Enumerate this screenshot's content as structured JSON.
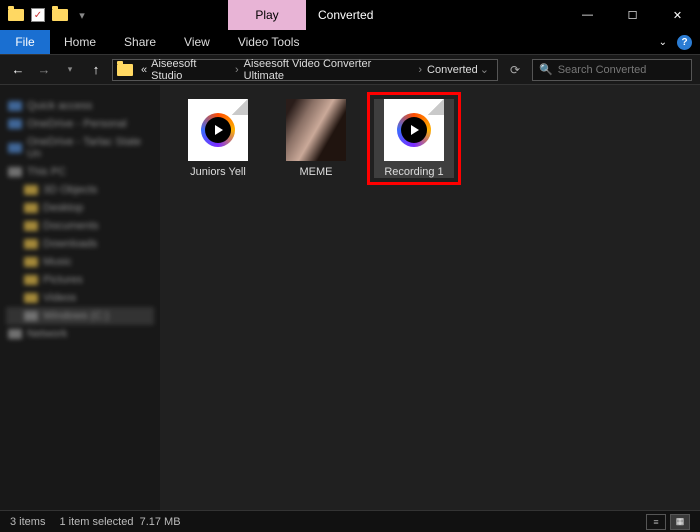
{
  "titlebar": {
    "contextual_tab": "Play",
    "window_title": "Converted",
    "minimize": "—",
    "maximize": "☐",
    "close": "✕"
  },
  "ribbon": {
    "file": "File",
    "tabs": [
      "Home",
      "Share",
      "View",
      "Video Tools"
    ]
  },
  "address": {
    "prefix": "«",
    "crumbs": [
      "Aiseesoft Studio",
      "Aiseesoft Video Converter Ultimate",
      "Converted"
    ],
    "search_placeholder": "Search Converted"
  },
  "sidebar": {
    "items": [
      {
        "label": "Quick access",
        "icon": "blue",
        "indent": false
      },
      {
        "label": "OneDrive - Personal",
        "icon": "blue",
        "indent": false
      },
      {
        "label": "OneDrive - Tarlac State Un",
        "icon": "blue",
        "indent": false
      },
      {
        "label": "This PC",
        "icon": "grey",
        "indent": false
      },
      {
        "label": "3D Objects",
        "icon": "default",
        "indent": true
      },
      {
        "label": "Desktop",
        "icon": "default",
        "indent": true
      },
      {
        "label": "Documents",
        "icon": "default",
        "indent": true
      },
      {
        "label": "Downloads",
        "icon": "default",
        "indent": true
      },
      {
        "label": "Music",
        "icon": "default",
        "indent": true
      },
      {
        "label": "Pictures",
        "icon": "default",
        "indent": true
      },
      {
        "label": "Videos",
        "icon": "default",
        "indent": true
      },
      {
        "label": "Windows (C:)",
        "icon": "grey",
        "indent": true,
        "sel": true
      },
      {
        "label": "Network",
        "icon": "grey",
        "indent": false
      }
    ]
  },
  "files": [
    {
      "name": "Juniors Yell",
      "type": "video",
      "selected": false
    },
    {
      "name": "MEME",
      "type": "image",
      "selected": false
    },
    {
      "name": "Recording 1",
      "type": "video",
      "selected": true
    }
  ],
  "status": {
    "count": "3 items",
    "selection": "1 item selected",
    "size": "7.17 MB"
  }
}
